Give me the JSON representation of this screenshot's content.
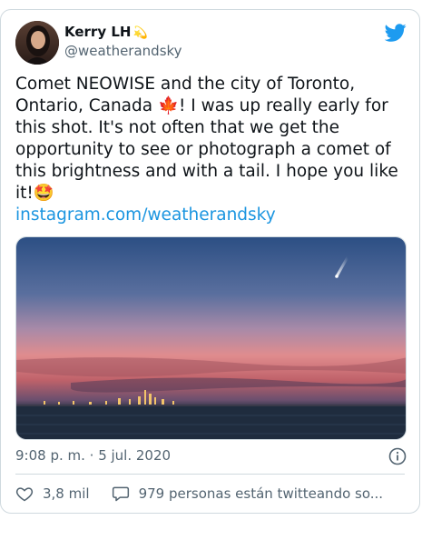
{
  "author": {
    "name": "Kerry LH",
    "name_emoji": "💫",
    "handle": "@weatherandsky"
  },
  "tweet": {
    "text": "Comet NEOWISE and the city of Toronto, Ontario, Canada 🍁! I was up really early for this shot. It's not often that we get the opportunity to see or photograph a comet of this brightness and with a tail. I hope you like it!🤩",
    "link": "instagram.com/weatherandsky",
    "timestamp": "9:08 p. m. · 5 jul. 2020"
  },
  "actions": {
    "likes": "3,8 mil",
    "conversation": "979 personas están twitteando so..."
  },
  "colors": {
    "link": "#1b95e0",
    "twitter_blue": "#1d9bf0",
    "text": "#0f1419",
    "muted": "#536471"
  },
  "icons": [
    "twitter-bird-icon",
    "info-icon",
    "heart-icon",
    "speech-bubble-icon"
  ]
}
